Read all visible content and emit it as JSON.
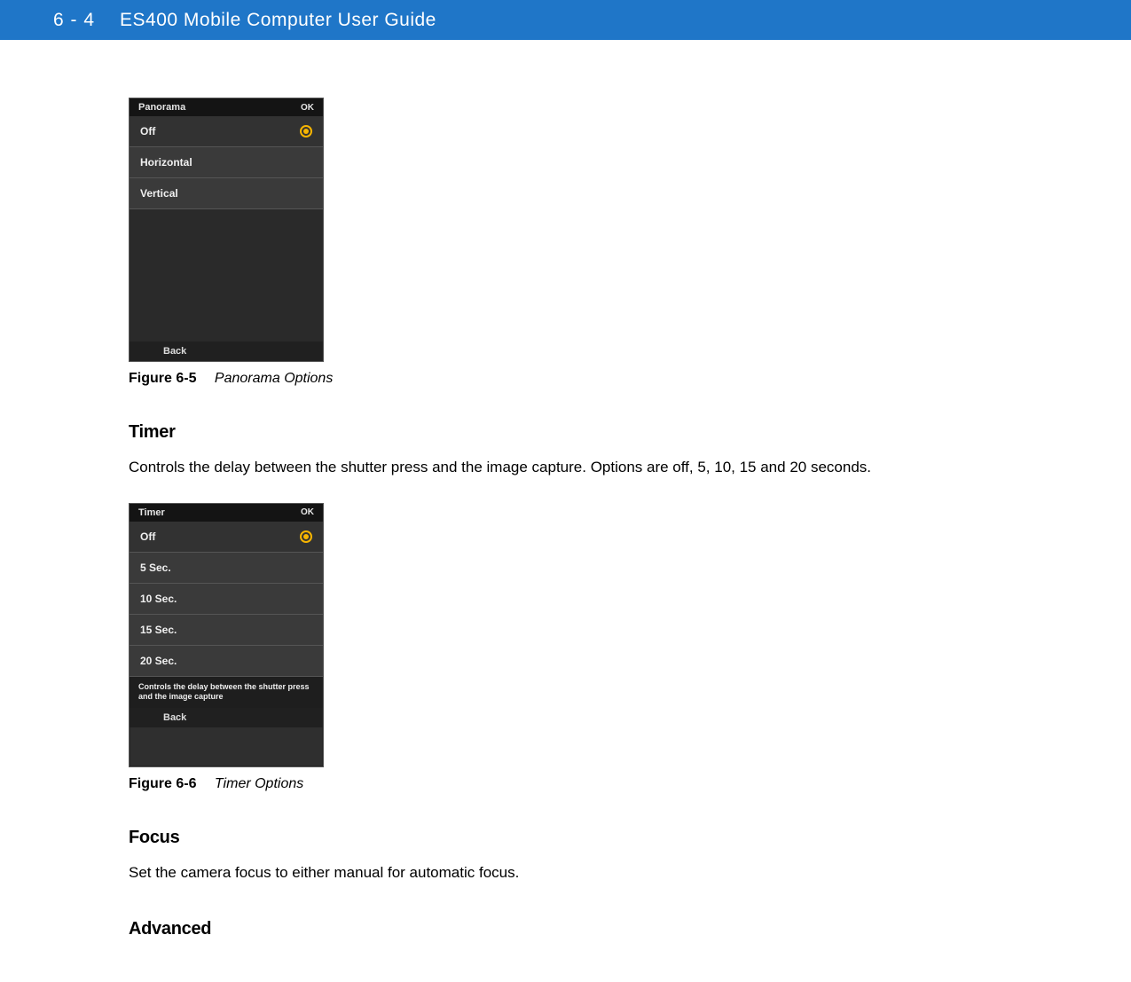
{
  "header": {
    "page_number": "6 - 4",
    "title": "ES400 Mobile Computer User Guide"
  },
  "figure1": {
    "label": "Figure 6-5",
    "caption": "Panorama Options",
    "screen": {
      "title": "Panorama",
      "ok": "OK",
      "options": [
        "Off",
        "Horizontal",
        "Vertical"
      ],
      "selected": "Off",
      "back": "Back"
    }
  },
  "section_timer": {
    "heading": "Timer",
    "body": "Controls the delay between the shutter press and the image capture. Options are off, 5, 10, 15 and 20 seconds."
  },
  "figure2": {
    "label": "Figure 6-6",
    "caption": "Timer Options",
    "screen": {
      "title": "Timer",
      "ok": "OK",
      "options": [
        "Off",
        "5 Sec.",
        "10 Sec.",
        "15 Sec.",
        "20 Sec."
      ],
      "selected": "Off",
      "hint": "Controls the delay between the shutter press and the image capture",
      "back": "Back"
    }
  },
  "section_focus": {
    "heading": "Focus",
    "body": "Set the camera focus to either manual for automatic focus."
  },
  "section_advanced": {
    "heading": "Advanced"
  }
}
